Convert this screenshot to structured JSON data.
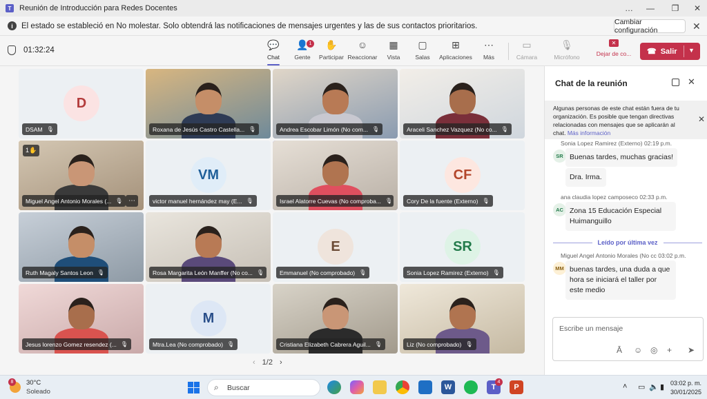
{
  "window": {
    "title": "Reunión de Introducción para Redes Docentes",
    "controls": [
      "…",
      "—",
      "❐",
      "✕"
    ]
  },
  "banner": {
    "text": "El estado se estableció en No molestar. Solo obtendrá las notificaciones de mensajes urgentes y las de sus contactos prioritarios.",
    "button": "Cambiar configuración"
  },
  "toolbar": {
    "timer": "01:32:24",
    "buttons": [
      {
        "label": "Chat",
        "icon": "chat-icon"
      },
      {
        "label": "Gente",
        "icon": "people-icon",
        "badge": "1"
      },
      {
        "label": "Participar",
        "icon": "raise-hand-icon"
      },
      {
        "label": "Reaccionar",
        "icon": "emoji-icon"
      },
      {
        "label": "Vista",
        "icon": "grid-icon"
      },
      {
        "label": "Salas",
        "icon": "rooms-icon"
      },
      {
        "label": "Aplicaciones",
        "icon": "add-icon"
      },
      {
        "label": "Más",
        "icon": "more-icon"
      },
      {
        "label": "Cámara",
        "icon": "camera-off-icon"
      },
      {
        "label": "Micrófono",
        "icon": "mic-off-icon"
      },
      {
        "label": "Dejar de co...",
        "icon": "stop-share-icon"
      }
    ],
    "leave": "Salir"
  },
  "participants": [
    {
      "name": "DSAM",
      "initials": "D",
      "video": false
    },
    {
      "name": "Roxana de Jesús Castro Castella...",
      "video": true
    },
    {
      "name": "Andrea Escobar Limón (No com...",
      "video": true
    },
    {
      "name": "Araceli Sanchez Vazquez (No co...",
      "video": true
    },
    {
      "name": "Miguel Angel Antonio Morales (...",
      "video": true,
      "hand": "1✋"
    },
    {
      "name": "victor manuel hernández may (E...",
      "initials": "VM",
      "video": false
    },
    {
      "name": "Israel Alatorre Cuevas (No comproba...",
      "video": true
    },
    {
      "name": "Cory De la fuente (Externo)",
      "initials": "CF",
      "video": false
    },
    {
      "name": "Ruth Magaly Santos Leon",
      "video": true
    },
    {
      "name": "Rosa Margarita León Manffer (No co...",
      "video": true
    },
    {
      "name": "Emmanuel (No comprobado)",
      "initials": "E",
      "video": false
    },
    {
      "name": "Sonia Lopez Ramirez (Externo)",
      "initials": "SR",
      "video": false
    },
    {
      "name": "Jesus lorenzo Gomez resendez (...",
      "video": true
    },
    {
      "name": "Mtra.Lea (No comprobado)",
      "initials": "M",
      "video": false
    },
    {
      "name": "Cristiana Elizabeth Cabrera Aguil...",
      "video": true
    },
    {
      "name": "Liz (No comprobado)",
      "video": true
    }
  ],
  "pager": "1/2",
  "chat": {
    "title": "Chat de la reunión",
    "notice": "Algunas personas de este chat están fuera de tu organización. Es posible que tengan directivas relacionadas con mensajes que se aplicarán al chat.",
    "notice_link": "Más información",
    "messages": [
      {
        "meta": "Sonia Lopez Ramirez (Externo)   02:19 p.m.",
        "avatar": "SR",
        "texts": [
          "Buenas tardes, muchas gracias!",
          "Dra. Irma."
        ]
      },
      {
        "meta": "ana claudia lopez camposeco   02:33 p.m.",
        "avatar": "AC",
        "texts": [
          "Zona 15 Educación Especial Huimanguillo"
        ]
      },
      {
        "meta": "Miguel Angel Antonio Morales (No cc   03:02 p.m.",
        "avatar": "MM",
        "texts": [
          "buenas tardes, una duda a que hora se iniciará el taller por este medio"
        ]
      }
    ],
    "last_read": "Leído por última vez",
    "compose_placeholder": "Escribe un mensaje"
  },
  "taskbar": {
    "temp": "30°C",
    "weather": "Soleado",
    "weather_badge": "8",
    "search": "Buscar",
    "teams_badge": "4",
    "time": "03:02 p. m.",
    "date": "30/01/2025"
  }
}
